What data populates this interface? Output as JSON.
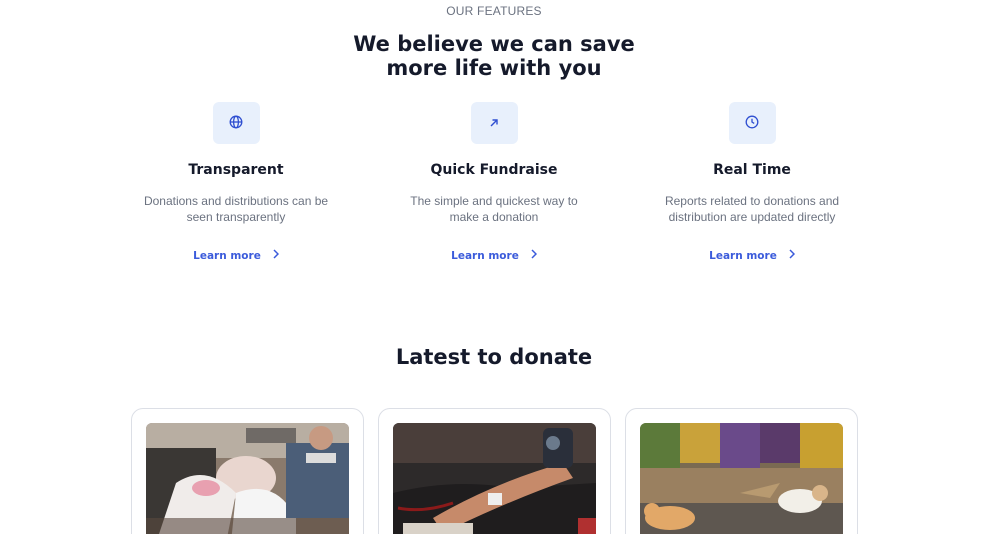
{
  "features_section": {
    "eyebrow": "OUR FEATURES",
    "headline_line1": "We believe we can save",
    "headline_line2": "more life with you",
    "items": [
      {
        "icon": "globe-icon",
        "title": "Transparent",
        "desc_line1": "Donations and distributions can be",
        "desc_line2": "seen transparently",
        "link_label": "Learn more"
      },
      {
        "icon": "arrow-up-right-icon",
        "title": "Quick Fundraise",
        "desc_line1": "The simple and quickest way to",
        "desc_line2": "make a donation",
        "link_label": "Learn more"
      },
      {
        "icon": "clock-icon",
        "title": "Real Time",
        "desc_line1": "Reports related to donations and",
        "desc_line2": "distribution are updated directly",
        "link_label": "Learn more"
      }
    ],
    "accent_color": "#3b5bdb",
    "icon_bg_color": "#e8f0fc"
  },
  "latest_section": {
    "title": "Latest to donate",
    "cards": [
      {
        "image": "volunteers-food-bags-photo"
      },
      {
        "image": "blood-donation-photo"
      },
      {
        "image": "stray-cats-photo"
      }
    ]
  }
}
